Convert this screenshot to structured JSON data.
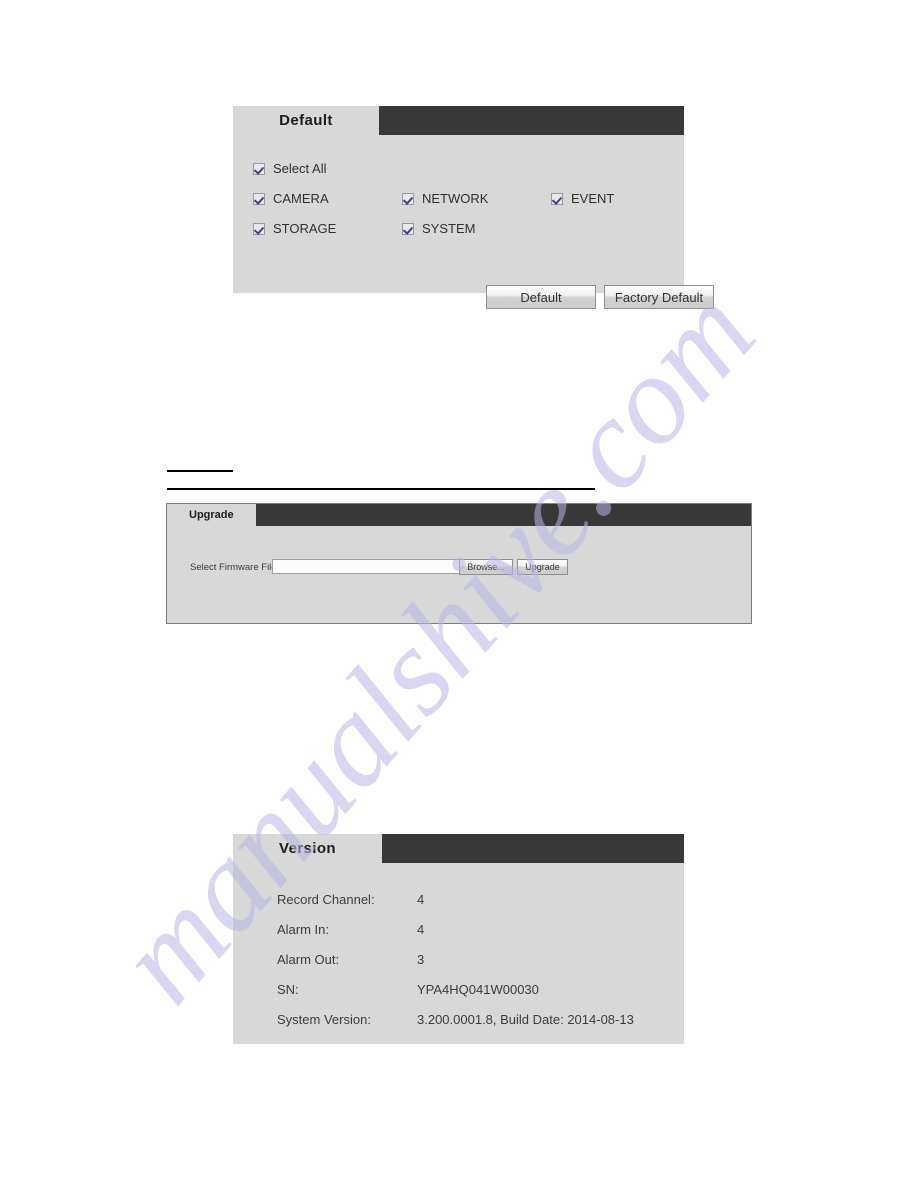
{
  "watermark": {
    "text": "manualshive.com",
    "color": "#b9b6e4"
  },
  "colors": {
    "panel_header": "#383838",
    "panel_body": "#d8d8d8",
    "checkmark": "#3b3f99",
    "text": "#2f2f2f"
  },
  "default_panel": {
    "tab_label": "Default",
    "select_all": {
      "label": "Select All",
      "checked": true
    },
    "options": [
      {
        "label": "CAMERA",
        "checked": true,
        "col": 0,
        "row": 0
      },
      {
        "label": "NETWORK",
        "checked": true,
        "col": 1,
        "row": 0
      },
      {
        "label": "EVENT",
        "checked": true,
        "col": 2,
        "row": 0
      },
      {
        "label": "STORAGE",
        "checked": true,
        "col": 0,
        "row": 1
      },
      {
        "label": "SYSTEM",
        "checked": true,
        "col": 1,
        "row": 1
      }
    ],
    "buttons": {
      "default": "Default",
      "factory_default": "Factory Default"
    }
  },
  "upgrade_panel": {
    "tab_label": "Upgrade",
    "field_label": "Select Firmware File",
    "input_value": "",
    "input_placeholder": "",
    "buttons": {
      "browse": "Browse...",
      "upgrade": "Upgrade"
    }
  },
  "version_panel": {
    "tab_label": "Version",
    "rows": [
      {
        "label": "Record Channel:",
        "value": "4"
      },
      {
        "label": "Alarm In:",
        "value": "4"
      },
      {
        "label": "Alarm Out:",
        "value": "3"
      },
      {
        "label": "SN:",
        "value": "YPA4HQ041W00030"
      },
      {
        "label": "System Version:",
        "value": "3.200.0001.8, Build Date: 2014-08-13"
      }
    ]
  }
}
